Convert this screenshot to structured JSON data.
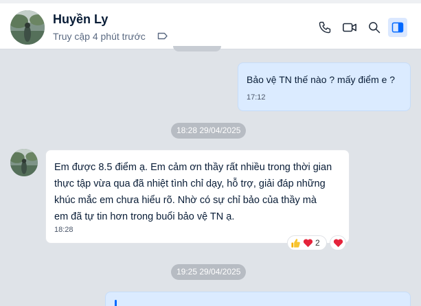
{
  "header": {
    "name": "Huyền Ly",
    "status": "Truy cập 4 phút trước",
    "icons": [
      "tag-icon",
      "phone-icon",
      "video-call-icon",
      "search-icon",
      "sidebar-toggle-icon"
    ]
  },
  "messages": [
    {
      "direction": "outgoing",
      "text": "Bảo vệ TN thế nào ? mấy điểm e ?",
      "time": "17:12"
    },
    {
      "direction": "incoming",
      "lines": [
        "Em được 8.5 điểm ạ. Em cảm ơn thầy rất nhiều trong thời gian",
        "thực tập vừa qua đã nhiệt tình chỉ dạy, hỗ trợ, giải đáp những",
        "khúc mắc em chưa hiểu rõ.  Nhờ có sự chỉ bảo của thầy mà",
        "em đã tự tin hơn trong buổi bảo vệ TN ạ."
      ],
      "time": "18:28",
      "reactions": {
        "icons": [
          "thumbs-up-icon",
          "heart-icon"
        ],
        "count": "2"
      }
    }
  ],
  "dividers": [
    "18:28 29/04/2025",
    "19:25 29/04/2025"
  ],
  "colors": {
    "accent": "#0068ff",
    "outgoing_bubble": "#dbebff",
    "heart": "#e5243b",
    "background": "#dfe3e8"
  }
}
